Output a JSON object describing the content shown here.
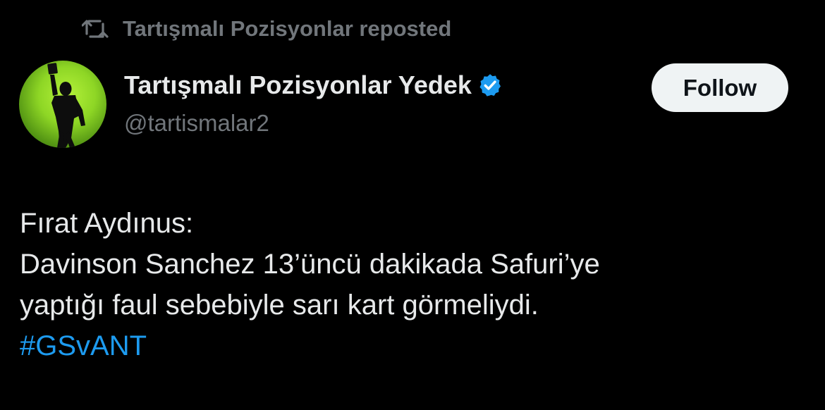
{
  "repost": {
    "icon": "repost-icon",
    "text": "Tartışmalı Pozisyonlar reposted"
  },
  "author": {
    "avatar_icon": "referee-silhouette-avatar",
    "display_name": "Tartışmalı Pozisyonlar Yedek",
    "verified_icon": "verified-badge-icon",
    "handle": "@tartismalar2"
  },
  "follow_button": {
    "label": "Follow"
  },
  "tweet": {
    "lines": [
      "Fırat Aydınus:",
      "Davinson Sanchez 13’üncü dakikada Safuri’ye",
      "yaptığı faul sebebiyle sarı kart görmeliydi."
    ],
    "hashtag": "#GSvANT"
  },
  "colors": {
    "background": "#000000",
    "primary_text": "#e7e9ea",
    "secondary_text": "#71767b",
    "accent_blue": "#1d9bf0",
    "avatar_green": "#8ed625",
    "button_bg": "#eff3f4"
  }
}
